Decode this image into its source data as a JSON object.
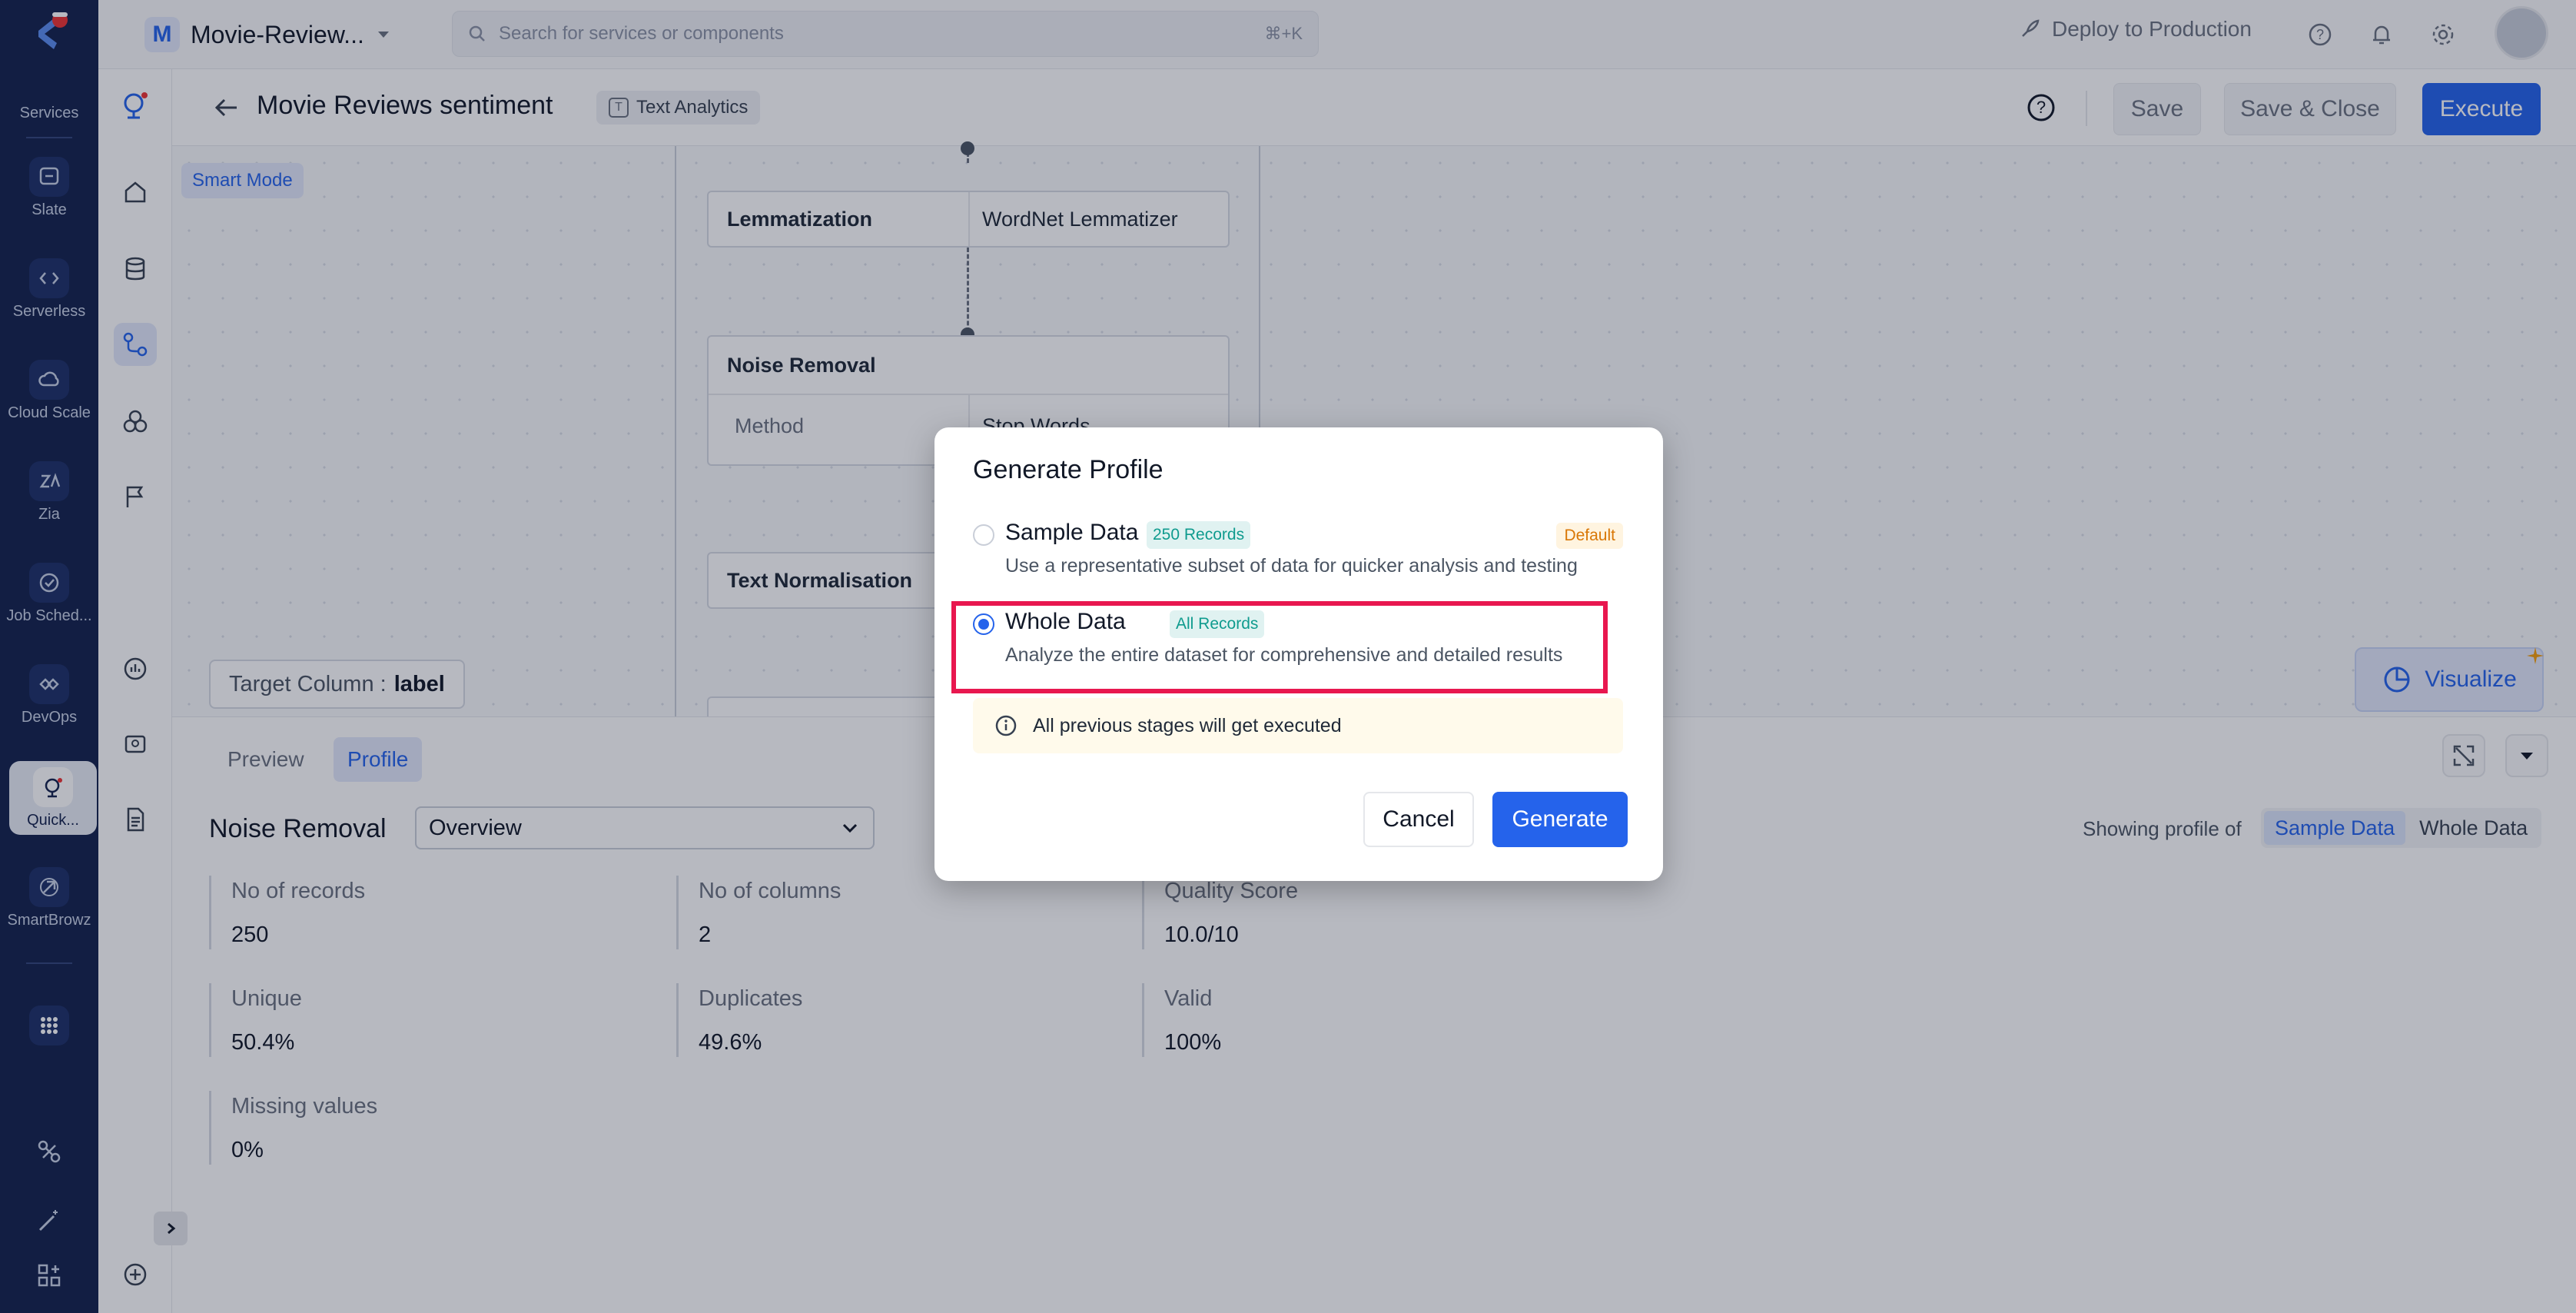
{
  "rail": {
    "items": [
      {
        "label": "Services"
      },
      {
        "label": "Slate"
      },
      {
        "label": "Serverless"
      },
      {
        "label": "Cloud Scale"
      },
      {
        "label": "Zia"
      },
      {
        "label": "Job Sched..."
      },
      {
        "label": "DevOps"
      },
      {
        "label": "Quick..."
      },
      {
        "label": "SmartBrowz"
      }
    ]
  },
  "topbar": {
    "project_initial": "M",
    "project_name": "Movie-Review...",
    "search_placeholder": "Search for services or components",
    "search_shortcut": "⌘+K",
    "deploy_label": "Deploy to Production"
  },
  "page": {
    "title": "Movie Reviews sentiment",
    "tag": "Text Analytics",
    "tag_icon": "T",
    "save": "Save",
    "save_close": "Save & Close",
    "execute": "Execute"
  },
  "canvas": {
    "smart_mode": "Smart Mode",
    "nodes": [
      {
        "name": "Lemmatization",
        "value": "WordNet Lemmatizer"
      },
      {
        "name": "Noise Removal",
        "sub_key": "Method",
        "sub_value": "Stop Words"
      },
      {
        "name": "Text Normalisation"
      }
    ],
    "target_label": "Target Column :",
    "target_value": "label",
    "visualize": "Visualize"
  },
  "bottom": {
    "tabs": [
      "Preview",
      "Profile"
    ],
    "stage_title": "Noise Removal",
    "view_select": "Overview",
    "showing_label": "Showing profile of",
    "segments": [
      "Sample Data",
      "Whole Data"
    ],
    "metrics": [
      {
        "label": "No of records",
        "value": "250"
      },
      {
        "label": "No of columns",
        "value": "2"
      },
      {
        "label": "Quality Score",
        "value": "10.0/10"
      },
      {
        "label": "Unique",
        "value": "50.4%"
      },
      {
        "label": "Duplicates",
        "value": "49.6%"
      },
      {
        "label": "Valid",
        "value": "100%"
      },
      {
        "label": "Missing values",
        "value": "0%"
      }
    ]
  },
  "modal": {
    "title": "Generate Profile",
    "options": [
      {
        "name": "Sample Data",
        "chip": "250 Records",
        "badge": "Default",
        "desc": "Use a representative subset of data for quicker analysis and testing",
        "selected": false
      },
      {
        "name": "Whole Data",
        "chip": "All Records",
        "desc": "Analyze the entire dataset for comprehensive and detailed results",
        "selected": true
      }
    ],
    "info": "All previous stages will get executed",
    "cancel": "Cancel",
    "generate": "Generate"
  },
  "colors": {
    "accent": "#2563eb",
    "rail": "#13224d",
    "highlight": "#e8174f"
  }
}
